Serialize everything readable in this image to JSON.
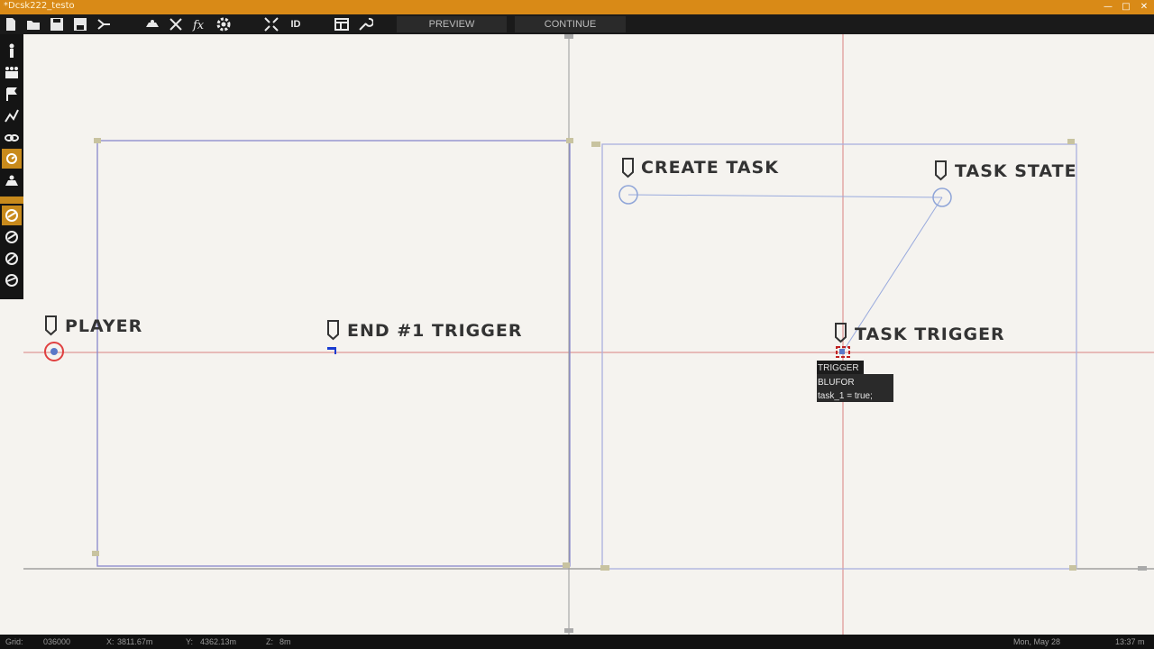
{
  "window": {
    "title": "*Dcsk222_testo"
  },
  "toolbar": {
    "preview_label": "PREVIEW",
    "continue_label": "CONTINUE",
    "id_label": "ID"
  },
  "entities": {
    "create_task": "CREATE TASK",
    "task_state": "TASK STATE",
    "player": "PLAYER",
    "end_trigger": "END #1 TRIGGER",
    "task_trigger": "TASK TRIGGER"
  },
  "tooltip": {
    "line1": "TRIGGER",
    "line2": "BLUFOR",
    "line3": "task_1 = true;"
  },
  "status": {
    "grid_label": "Grid:",
    "grid_value": "036000",
    "x_label": "X:",
    "x_value": "3811.67m",
    "y_label": "Y:",
    "y_value": "4362.13m",
    "z_label": "Z:",
    "z_value": "8m",
    "date": "Mon, May 28",
    "time": "13:37 m"
  },
  "colors": {
    "accent": "#d98a17",
    "axis_line": "#d98080",
    "area_line": "#8888cc",
    "link_line": "#99aadd"
  }
}
